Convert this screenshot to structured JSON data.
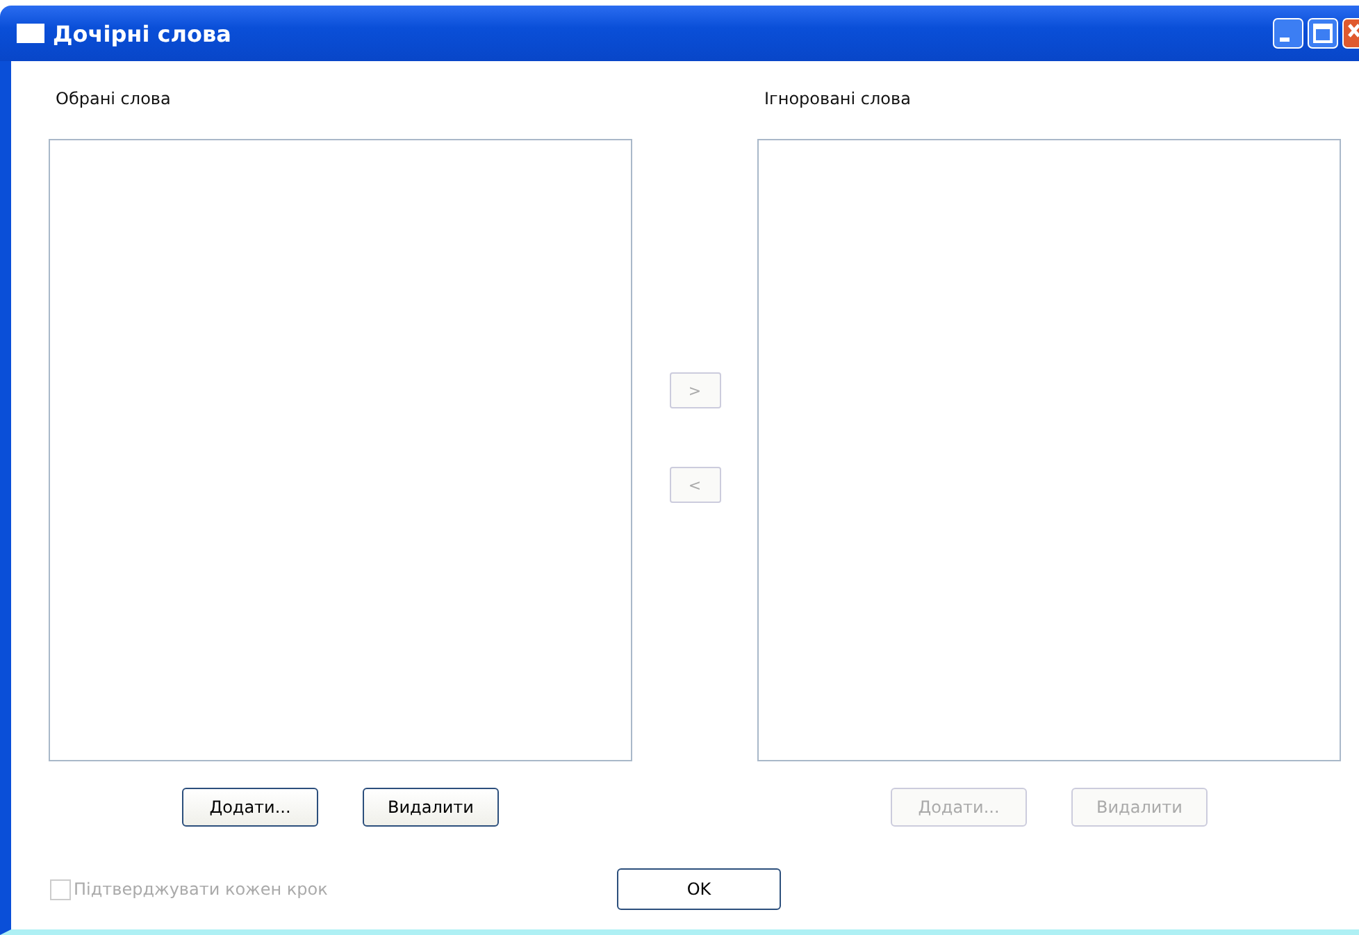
{
  "window": {
    "title": "Дочірні слова"
  },
  "panels": [
    {
      "label": "Обрані слова",
      "buttons": [
        {
          "label": "Додати...",
          "disabled": false
        },
        {
          "label": "Видалити",
          "disabled": false
        }
      ]
    },
    {
      "label": "Ігноровані слова",
      "buttons": [
        {
          "label": "Додати...",
          "disabled": true
        },
        {
          "label": "Видалити",
          "disabled": true
        }
      ]
    }
  ],
  "move_buttons": [
    {
      "label": ">",
      "disabled": true
    },
    {
      "label": "<",
      "disabled": true
    }
  ],
  "confirm_checkbox": {
    "label": "Підтверджувати кожен крок",
    "checked": false,
    "disabled": true
  },
  "ok_button": {
    "label": "OK"
  }
}
